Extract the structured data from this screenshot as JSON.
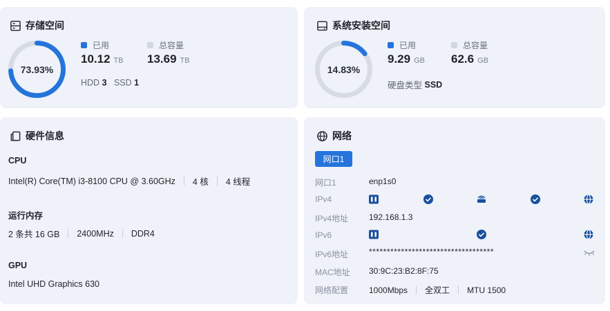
{
  "storage": {
    "title": "存储空间",
    "percent_label": "73.93%",
    "used_fraction": 0.7393,
    "used_label": "已用",
    "used_value": "10.12",
    "used_unit": "TB",
    "total_label": "总容量",
    "total_value": "13.69",
    "total_unit": "TB",
    "hdd_label": "HDD",
    "hdd_count": "3",
    "ssd_label": "SSD",
    "ssd_count": "1"
  },
  "system_storage": {
    "title": "系统安装空间",
    "percent_label": "14.83%",
    "used_fraction": 0.1483,
    "used_label": "已用",
    "used_value": "9.29",
    "used_unit": "GB",
    "total_label": "总容量",
    "total_value": "62.6",
    "total_unit": "GB",
    "disk_type_label": "硬盘类型",
    "disk_type_value": "SSD"
  },
  "hardware": {
    "title": "硬件信息",
    "cpu_heading": "CPU",
    "cpu_model": "Intel(R) Core(TM) i3-8100 CPU @ 3.60GHz",
    "cpu_cores": "4 核",
    "cpu_threads": "4 线程",
    "memory_heading": "运行内存",
    "memory_size": "2 条共 16 GB",
    "memory_speed": "2400MHz",
    "memory_type": "DDR4",
    "gpu_heading": "GPU",
    "gpu_model": "Intel UHD Graphics 630"
  },
  "network": {
    "title": "网络",
    "tab_label": "网口1",
    "rows": {
      "port_label": "网口1",
      "port_value": "enp1s0",
      "ipv4_label": "IPv4",
      "ipv4_addr_label": "IPv4地址",
      "ipv4_addr_value": "192.168.1.3",
      "ipv6_label": "IPv6",
      "ipv6_addr_label": "IPv6地址",
      "ipv6_addr_value": "***********************************",
      "mac_label": "MAC地址",
      "mac_value": "30:9C:23:B2:8F:75",
      "config_label": "网络配置",
      "speed": "1000Mbps",
      "duplex": "全双工",
      "mtu": "MTU 1500"
    }
  },
  "colors": {
    "accent": "#2574db",
    "track": "#d7dbe3",
    "card_bg": "#eff2f8",
    "node_dark": "#1a4f9e"
  },
  "icons": {
    "storage": "storage-icon",
    "system": "hard-drive-icon",
    "hardware": "hardware-icon",
    "network": "globe-icon",
    "eye_off": "eye-closed-icon"
  }
}
